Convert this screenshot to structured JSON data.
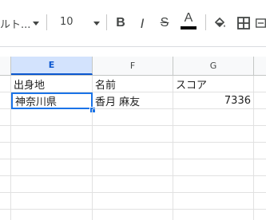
{
  "toolbar": {
    "font_name": "ルト...",
    "font_size": "10",
    "bold_label": "B",
    "italic_label": "I",
    "strikethrough_label": "S",
    "text_color_label": "A",
    "text_color": "#000000",
    "icons": [
      "font-dropdown-arrow",
      "font-size-dropdown-arrow",
      "bold",
      "italic",
      "strikethrough",
      "text-color",
      "fill-color",
      "borders",
      "merge"
    ]
  },
  "grid": {
    "columns": [
      "E",
      "F",
      "G"
    ],
    "selected_column": "E",
    "rows": [
      [
        "出身地",
        "名前",
        "スコア"
      ],
      [
        "神奈川県",
        "香月 麻友",
        "7336"
      ]
    ],
    "active_cell": "E2",
    "accent_color": "#1a73e8"
  }
}
